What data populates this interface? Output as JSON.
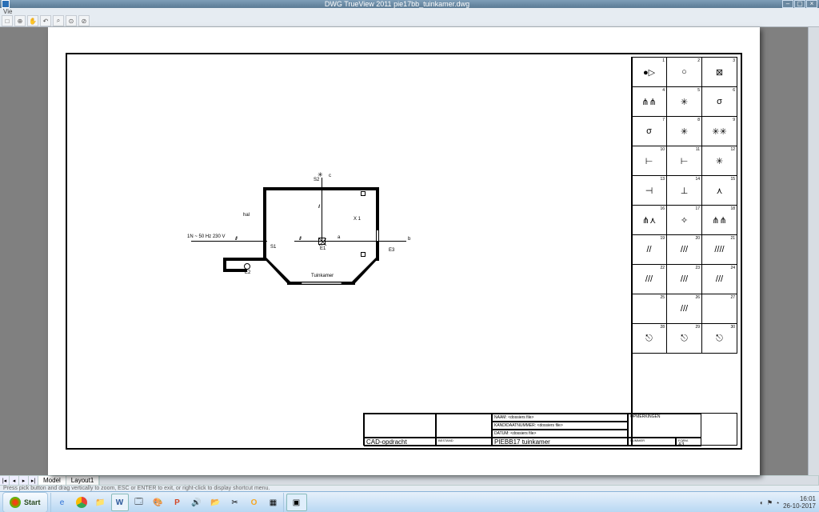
{
  "app": {
    "title": "DWG TrueView 2011   pie17bb_tuinkamer.dwg",
    "menu_label": "Vie"
  },
  "toolbar_icons": [
    "new",
    "open",
    "zoom-extents",
    "pan",
    "zoom-win",
    "zoom",
    "orbit",
    "cancel"
  ],
  "tabs": {
    "model": "Model",
    "layout1": "Layout1"
  },
  "status": "Press pick button and drag vertically to zoom, ESC or ENTER to exit, or right-click to display shortcut menu.",
  "drawing": {
    "power_note": "1N ~ 50 Hz 230 V",
    "room_main": "Tuinkamer",
    "room_hal": "hal",
    "s1": "S1",
    "s2": "S2",
    "e1": "E1",
    "e2": "E2",
    "e3": "E3",
    "x1": "X 1",
    "a": "a",
    "b": "b",
    "c": "c"
  },
  "legend": {
    "nums": [
      "1",
      "2",
      "3",
      "4",
      "5",
      "6",
      "7",
      "8",
      "9",
      "10",
      "11",
      "12",
      "13",
      "14",
      "15",
      "16",
      "17",
      "18",
      "19",
      "20",
      "21",
      "22",
      "23",
      "24",
      "25",
      "26",
      "27",
      "28",
      "29",
      "30"
    ],
    "syms": [
      "●▷",
      "○",
      "⊠",
      "⋔⋔",
      "✳",
      "σ",
      "σ",
      "✳",
      "✳✳",
      "⊢",
      "⊢",
      "✳",
      "⊣",
      "⊥",
      "⋏",
      "⋔⋏",
      "✧",
      "⋔⋔",
      "//",
      "///",
      "////",
      "///",
      "///",
      "///",
      "",
      "///",
      "",
      "⎋",
      "⎋",
      "⎋"
    ]
  },
  "titleblock": {
    "naam_label": "NAAM:  <dossiers file>",
    "kandidaat_label": "KANDIDAATNUMMER:  <dossiers file>",
    "datum_label": "DATUM:  <dossiers file>",
    "opmerk_label": "OPMERKINGEN",
    "cad_label": "CAD-opdracht",
    "bestand_label": "BESTAND",
    "project": "PIEBB17 tuinkamer",
    "nummer_label": "NUMMER",
    "form_label": "FORM.",
    "form_val": "A3"
  },
  "taskbar": {
    "start": "Start",
    "icons": [
      "ie",
      "chrome",
      "explorer",
      "word",
      "calc",
      "paint",
      "ppt",
      "music",
      "mail",
      "snip",
      "outlook",
      "app"
    ],
    "clock_time": "16:01",
    "clock_date": "26-10-2017"
  }
}
